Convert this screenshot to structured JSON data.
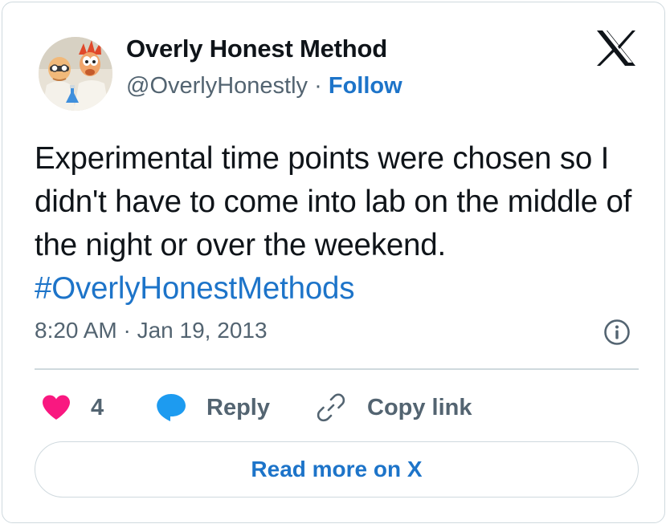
{
  "author": {
    "display_name": "Overly Honest Method",
    "handle": "@OverlyHonestly",
    "separator": "·",
    "follow_label": "Follow"
  },
  "tweet": {
    "text": "Experimental time points were chosen so I didn't have to come into lab on the middle of the night or over the weekend. ",
    "hashtag": "#OverlyHonestMethods",
    "timestamp": "8:20 AM · Jan 19, 2013"
  },
  "actions": {
    "like_count": "4",
    "reply_label": "Reply",
    "copy_link_label": "Copy link"
  },
  "read_more_label": "Read more on X",
  "colors": {
    "accent": "#1d74c9",
    "like": "#f91880",
    "reply": "#1d9bf0",
    "text": "#0f1419",
    "muted": "#536471",
    "border": "#cfd9de"
  },
  "icons": [
    "x-logo-icon",
    "info-icon",
    "heart-icon",
    "reply-bubble-icon",
    "link-icon"
  ]
}
